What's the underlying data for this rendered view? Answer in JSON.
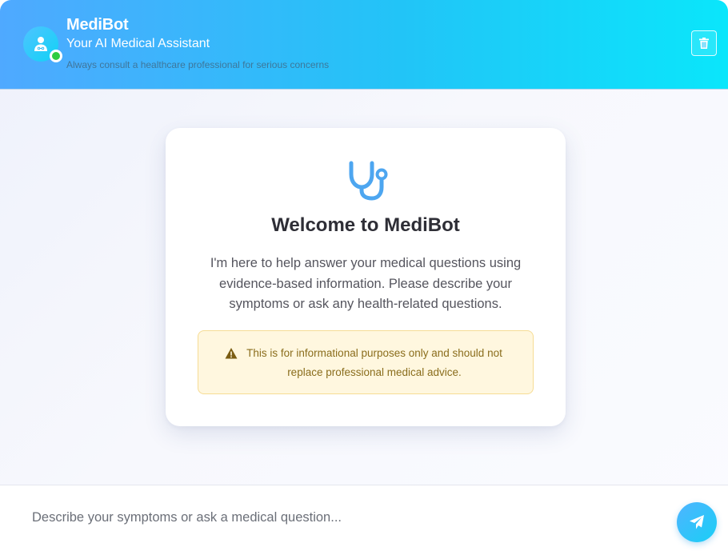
{
  "header": {
    "title": "MediBot",
    "subtitle": "Your AI Medical Assistant",
    "disclaimer": "Always consult a healthcare professional for serious concerns",
    "avatar_icon": "user-doctor-icon",
    "status": "online",
    "clear_icon": "trash-icon"
  },
  "welcome": {
    "icon": "stethoscope-icon",
    "title": "Welcome to MediBot",
    "text_lines": [
      "I'm here to help answer your medical questions using",
      "evidence-based information. Please describe your",
      "symptoms or ask any health-related questions."
    ],
    "notice": {
      "icon": "warning-triangle-icon",
      "line1": "This is for informational purposes only and should not",
      "line2": "replace professional medical advice."
    }
  },
  "input": {
    "placeholder": "Describe your symptoms or ask a medical question...",
    "value": "",
    "send_icon": "paper-plane-icon"
  },
  "colors": {
    "header_gradient_start": "#4fa9ff",
    "header_gradient_end": "#0ae6fb",
    "accent": "#4da6f0",
    "status_online": "#2ecc40",
    "notice_bg": "#fff7df",
    "notice_text": "#8a6d1c"
  }
}
